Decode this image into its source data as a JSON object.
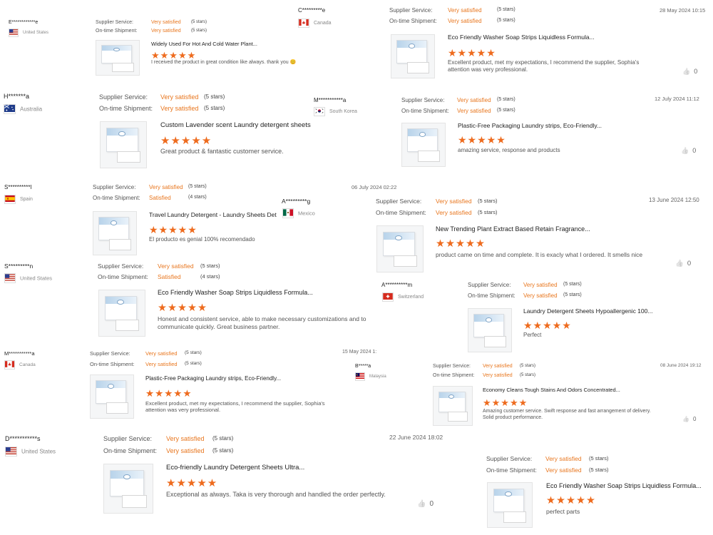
{
  "labels": {
    "supplier": "Supplier Service:",
    "shipment": "On-time Shipment:"
  },
  "reviews": [
    {
      "user": "E************e",
      "country": "United States",
      "flag": "us",
      "supplier": "Very satisfied",
      "supplier_stars": "(5 stars)",
      "shipment": "Very satisfied",
      "shipment_stars": "(5 stars)",
      "title": "Widely Used For Hot And Cold Water Plant...",
      "rating": "★★★★★",
      "comment": "I received the product in great condition like always. thank you 😊",
      "date": "",
      "likes": ""
    },
    {
      "user": "C*********e",
      "country": "Canada",
      "flag": "ca",
      "supplier": "Very satisfied",
      "supplier_stars": "(5 stars)",
      "shipment": "Very satisfied",
      "shipment_stars": "(5 stars)",
      "title": "Eco Friendly Washer Soap Strips Liquidless Formula...",
      "rating": "★★★★★",
      "comment": "Excellent product, met my expectations, I recommend the supplier, Sophia's attention was very professional.",
      "date": "28 May 2024 10:15",
      "likes": "0"
    },
    {
      "user": "H*******a",
      "country": "Australia",
      "flag": "au",
      "supplier": "Very satisfied",
      "supplier_stars": "(5 stars)",
      "shipment": "Very satisfied",
      "shipment_stars": "(5 stars)",
      "title": "Custom Lavender scent Laundry detergent sheets",
      "rating": "★★★★★",
      "comment": "Great product & fantastic customer service.",
      "date": "",
      "likes": ""
    },
    {
      "user": "M***********a",
      "country": "South Korea",
      "flag": "kr",
      "supplier": "Very satisfied",
      "supplier_stars": "(5 stars)",
      "shipment": "Very satisfied",
      "shipment_stars": "(5 stars)",
      "title": "Plastic-Free Packaging Laundry strips, Eco-Friendly...",
      "rating": "★★★★★",
      "comment": "amazing service, response and products",
      "date": "12 July 2024 11:12",
      "likes": "0"
    },
    {
      "user": "S**********l",
      "country": "Spain",
      "flag": "es",
      "supplier": "Very satisfied",
      "supplier_stars": "(5 stars)",
      "shipment": "Satisfied",
      "shipment_stars": "(4 stars)",
      "title": "Travel Laundry Detergent - Laundry Sheets Det",
      "rating": "★★★★★",
      "comment": "El producto es genial 100% recomendado",
      "date": "06 July 2024 02:22",
      "likes": ""
    },
    {
      "user": "A*********g",
      "country": "Mexico",
      "flag": "mx",
      "supplier": "Very satisfied",
      "supplier_stars": "(5 stars)",
      "shipment": "Very satisfied",
      "shipment_stars": "(5 stars)",
      "title": "New Trending Plant Extract Based Retain Fragrance...",
      "rating": "★★★★★",
      "comment": "product came on time and complete. It is exacly what I ordered. It smells nice",
      "date": "13 June 2024 12:50",
      "likes": "0"
    },
    {
      "user": "S*********n",
      "country": "United States",
      "flag": "us",
      "supplier": "Very satisfied",
      "supplier_stars": "(5 stars)",
      "shipment": "Satisfied",
      "shipment_stars": "(4 stars)",
      "title": "Eco Friendly Washer Soap Strips Liquidless Formula...",
      "rating": "★★★★★",
      "comment": "Honest and consistent service, able to make necessary customizations and to communicate quickly. Great business partner.",
      "date": "",
      "likes": ""
    },
    {
      "user": "A**********m",
      "country": "Switzerland",
      "flag": "ch",
      "supplier": "Very satisfied",
      "supplier_stars": "(5 stars)",
      "shipment": "Very satisfied",
      "shipment_stars": "(5 stars)",
      "title": "Laundry Detergent Sheets Hypoallergenic 100...",
      "rating": "★★★★★",
      "comment": "Perfect",
      "date": "",
      "likes": ""
    },
    {
      "user": "M***********a",
      "country": "Canada",
      "flag": "ca",
      "supplier": "Very satisfied",
      "supplier_stars": "(5 stars)",
      "shipment": "Very satisfied",
      "shipment_stars": "(5 stars)",
      "title": "Plastic-Free Packaging Laundry strips, Eco-Friendly...",
      "rating": "★★★★★",
      "comment": "Excellent product, met my expectations, I recommend the supplier, Sophia's attention was very professional.",
      "date": "15 May 2024 1:",
      "likes": ""
    },
    {
      "user": "B*****a",
      "country": "Malaysia",
      "flag": "my",
      "supplier": "Very satisfied",
      "supplier_stars": "(5 stars)",
      "shipment": "Very satisfied",
      "shipment_stars": "(5 stars)",
      "title": "Economy Cleans Tough Stains And Odors Concentrated...",
      "rating": "★★★★★",
      "comment": "Amazing customer service. Swift response and fast arrangement of delivery. Solid product performance.",
      "date": "08 June 2024 19:12",
      "likes": "0"
    },
    {
      "user": "D***********s",
      "country": "United States",
      "flag": "us",
      "supplier": "Very satisfied",
      "supplier_stars": "(5 stars)",
      "shipment": "Very satisfied",
      "shipment_stars": "(5 stars)",
      "title": "Eco-friendly Laundry Detergent Sheets Ultra...",
      "rating": "★★★★★",
      "comment": "Exceptional as always. Taka is very thorough and handled the order perfectly.",
      "date": "22 June 2024 18:02",
      "likes": "0"
    },
    {
      "user": "",
      "country": "",
      "flag": "",
      "supplier": "Very satisfied",
      "supplier_stars": "(5 stars)",
      "shipment": "Very satisfied",
      "shipment_stars": "(5 stars)",
      "title": "Eco Friendly Washer Soap Strips Liquidless Formula...",
      "rating": "★★★★★",
      "comment": "perfect parts",
      "date": "",
      "likes": ""
    }
  ]
}
